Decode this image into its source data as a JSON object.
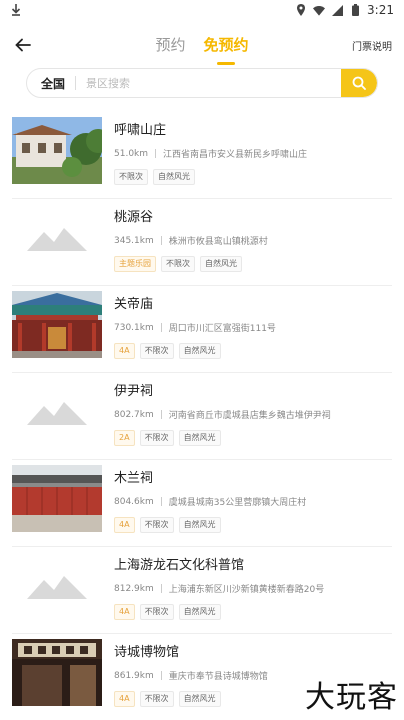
{
  "status_bar": {
    "time": "3:21",
    "left_icon": "download-icon",
    "icons": [
      "location-icon",
      "wifi-icon",
      "signal-icon",
      "battery-icon"
    ]
  },
  "header": {
    "tabs": [
      {
        "label": "预约",
        "active": false
      },
      {
        "label": "免预约",
        "active": true
      }
    ],
    "right_link": "门票说明"
  },
  "search": {
    "region": "全国",
    "placeholder": "景区搜索"
  },
  "colors": {
    "accent": "#F5B800",
    "search_button": "#F5C518"
  },
  "items": [
    {
      "name": "呼啸山庄",
      "distance": "51.0km",
      "address": "江西省南昌市安义县新民乡呼啸山庄",
      "tags": [
        "不限次",
        "自然风光"
      ],
      "level": "",
      "theme": "",
      "image": "photo-building"
    },
    {
      "name": "桃源谷",
      "distance": "345.1km",
      "address": "株洲市攸县鸾山镇桃源村",
      "tags": [
        "不限次",
        "自然风光"
      ],
      "level": "",
      "theme": "主题乐园",
      "image": "placeholder"
    },
    {
      "name": "关帝庙",
      "distance": "730.1km",
      "address": "周口市川汇区富强街111号",
      "tags": [
        "不限次",
        "自然风光"
      ],
      "level": "4A",
      "theme": "",
      "image": "photo-temple"
    },
    {
      "name": "伊尹祠",
      "distance": "802.7km",
      "address": "河南省商丘市虞城县店集乡魏古堆伊尹祠",
      "tags": [
        "不限次",
        "自然风光"
      ],
      "level": "2A",
      "theme": "",
      "image": "placeholder"
    },
    {
      "name": "木兰祠",
      "distance": "804.6km",
      "address": "虞城县城南35公里营廓镇大周庄村",
      "tags": [
        "不限次",
        "自然风光"
      ],
      "level": "4A",
      "theme": "",
      "image": "photo-wall"
    },
    {
      "name": "上海游龙石文化科普馆",
      "distance": "812.9km",
      "address": "上海浦东新区川沙新镇黄楼新春路20号",
      "tags": [
        "不限次",
        "自然风光"
      ],
      "level": "4A",
      "theme": "",
      "image": "placeholder"
    },
    {
      "name": "诗城博物馆",
      "distance": "861.9km",
      "address": "重庆市奉节县诗城博物馆",
      "tags": [
        "不限次",
        "自然风光"
      ],
      "level": "4A",
      "theme": "",
      "image": "photo-museum"
    }
  ],
  "watermark": "大玩客"
}
